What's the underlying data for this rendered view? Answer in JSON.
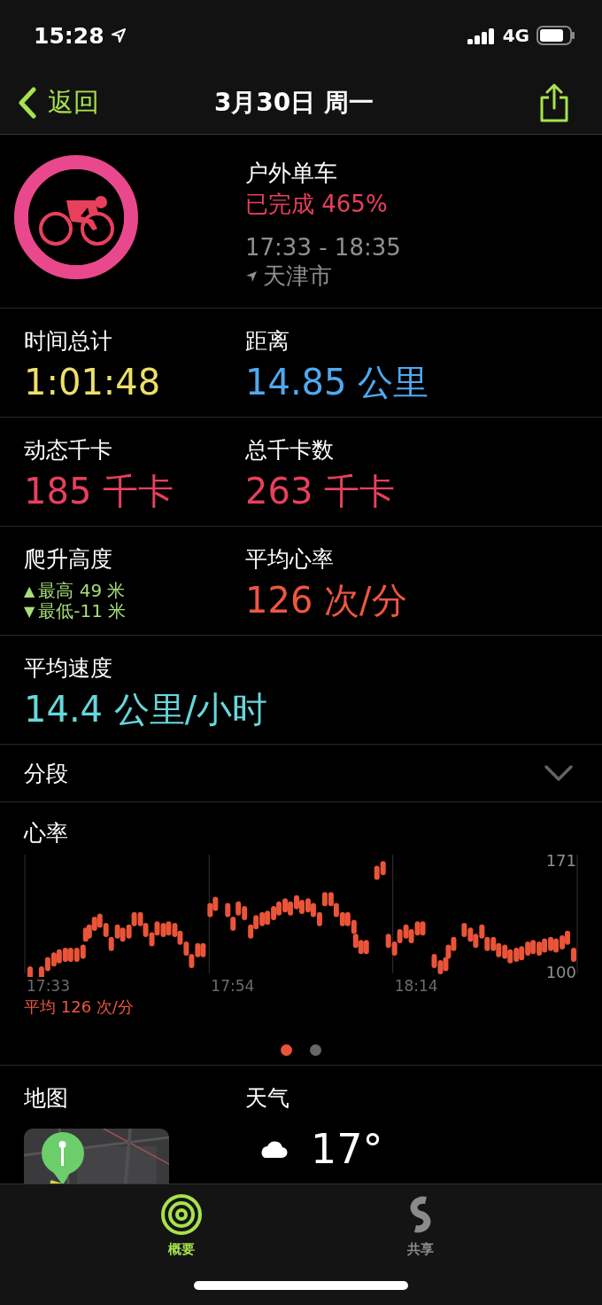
{
  "status_bar": {
    "time": "15:28",
    "network": "4G"
  },
  "nav": {
    "back": "返回",
    "title": "3月30日 周一"
  },
  "workout": {
    "name": "户外单车",
    "completion": "已完成 465%",
    "time_range": "17:33 - 18:35",
    "location": "天津市"
  },
  "metric_rows": [
    [
      {
        "kind": "value",
        "label": "时间总计",
        "value": "1:01:48",
        "color": "#ece06a"
      },
      {
        "kind": "value",
        "label": "距离",
        "value": "14.85 公里",
        "color": "#4ea9f0"
      }
    ],
    [
      {
        "kind": "value",
        "label": "动态千卡",
        "value": "185 千卡",
        "color": "#e8405c"
      },
      {
        "kind": "value",
        "label": "总千卡数",
        "value": "263 千卡",
        "color": "#e8405c"
      }
    ],
    [
      {
        "kind": "elevation",
        "label": "爬升高度",
        "lines": [
          {
            "marker": "▲",
            "text": "最高 49 米"
          },
          {
            "marker": "▼",
            "text": "最低-11 米"
          }
        ],
        "color": "#a6df7c"
      },
      {
        "kind": "value",
        "label": "平均心率",
        "value": "126 次/分",
        "color": "#ee5640"
      }
    ],
    [
      {
        "kind": "value",
        "label": "平均速度",
        "value": "14.4 公里/小时",
        "color": "#66d7dc"
      }
    ]
  ],
  "splits": {
    "label": "分段",
    "expanded": false
  },
  "heart_rate": {
    "title": "心率",
    "max_label": "171",
    "min_label": "100",
    "time_labels": [
      "17:33",
      "17:54",
      "18:14"
    ],
    "average": "平均 126 次/分"
  },
  "pages": [
    {
      "selected": true
    },
    {
      "selected": false
    }
  ],
  "map": {
    "title": "地图",
    "kind": "picture"
  },
  "weather": {
    "title": "天气",
    "temperature": "17°"
  },
  "tab_bar": [
    {
      "label": "概要",
      "selected": true
    },
    {
      "label": "共享",
      "selected": false
    }
  ]
}
